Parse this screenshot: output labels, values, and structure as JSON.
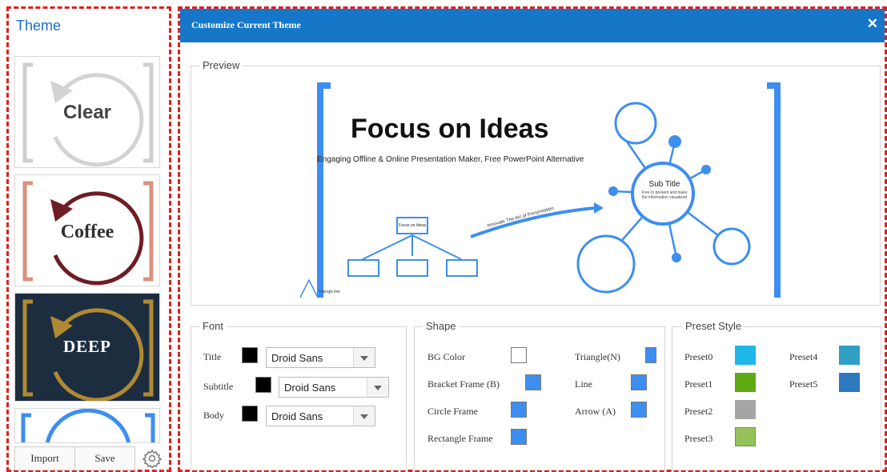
{
  "sidebar": {
    "title": "Theme",
    "themes": [
      {
        "label": "Clear"
      },
      {
        "label": "Coffee"
      },
      {
        "label": "DEEP"
      }
    ],
    "import_label": "Import",
    "save_label": "Save"
  },
  "dialog": {
    "title": "Customize Current Theme",
    "close": "✕",
    "preview": {
      "legend": "Preview",
      "headline": "Focus on Ideas",
      "tagline": "Engaging Offline & Online Presentation Maker, Free PowerPoint Alternative",
      "sub_title": "Sub Title",
      "sub_text_1": "Free to present and make",
      "sub_text_2": "the information visualized",
      "focus_box": "Focus on Ideas",
      "arrow_text": "Innovate The Art of Presentation",
      "triangle_text": "Triangle line"
    },
    "font": {
      "legend": "Font",
      "rows": [
        {
          "label": "Title",
          "color": "#000000",
          "font": "Droid Sans"
        },
        {
          "label": "Subtitle",
          "color": "#000000",
          "font": "Droid Sans"
        },
        {
          "label": "Body",
          "color": "#000000",
          "font": "Droid Sans"
        }
      ]
    },
    "shape": {
      "legend": "Shape",
      "items": [
        {
          "label": "BG Color",
          "color": "#ffffff"
        },
        {
          "label": "Bracket Frame (B)",
          "color": "#3d8ef0"
        },
        {
          "label": "Circle Frame",
          "color": "#3d8ef0"
        },
        {
          "label": "Rectangle Frame",
          "color": "#3d8ef0"
        },
        {
          "label": "Triangle(N)",
          "color": "#3d8ef0"
        },
        {
          "label": "Line",
          "color": "#3d8ef0"
        },
        {
          "label": "Arrow (A)",
          "color": "#3d8ef0"
        }
      ]
    },
    "preset": {
      "legend": "Preset Style",
      "items": [
        {
          "label": "Preset0",
          "color": "#1fb7e6"
        },
        {
          "label": "Preset1",
          "color": "#5faa12"
        },
        {
          "label": "Preset2",
          "color": "#a5a5a5"
        },
        {
          "label": "Preset3",
          "color": "#94c15a"
        },
        {
          "label": "Preset4",
          "color": "#2fa0c4"
        },
        {
          "label": "Preset5",
          "color": "#2e79c0"
        }
      ]
    }
  }
}
